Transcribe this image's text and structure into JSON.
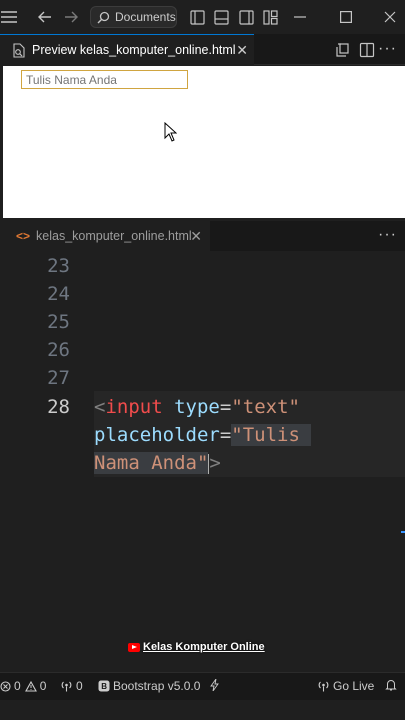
{
  "titlebar": {
    "search_placeholder": "Documents"
  },
  "preview_tab": {
    "label": "Preview kelas_komputer_online.html",
    "close": "✕"
  },
  "preview": {
    "input_placeholder": "Tulis Nama Anda"
  },
  "editor_tab": {
    "icon_text": "<>",
    "label": "kelas_komputer_online.html",
    "close": "✕"
  },
  "more_label": "···",
  "editor": {
    "line_numbers": [
      "23",
      "24",
      "25",
      "26",
      "27",
      "28"
    ],
    "code": {
      "open": "<",
      "tag": "input",
      "attr1": "type",
      "eq": "=",
      "val1": "\"text\"",
      "attr2": "placeholder",
      "val2_line1": "\"Tulis",
      "val2_line2": "Nama Anda",
      "val2_quote": "\"",
      "close": ">"
    }
  },
  "watermark": "Kelas Komputer Online",
  "statusbar": {
    "errors": "0",
    "warnings": "0",
    "ports": "0",
    "bootstrap": "Bootstrap v5.0.0",
    "go_live": "Go Live"
  },
  "colors": {
    "accent": "#0078d4",
    "tag": "#f14c4c",
    "attr": "#9cdcfe",
    "string": "#ce9178"
  }
}
